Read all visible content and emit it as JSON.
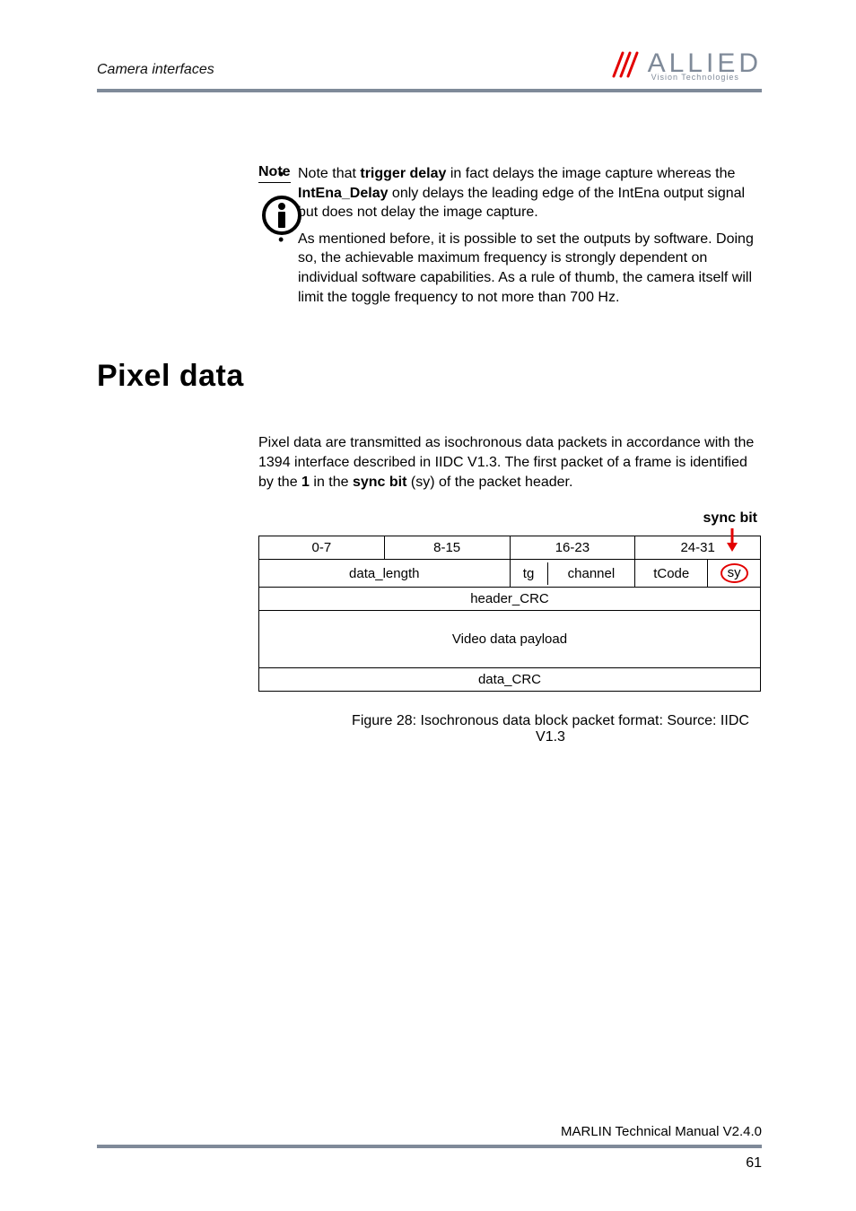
{
  "header": {
    "section": "Camera interfaces",
    "logo_main": "ALLIED",
    "logo_sub": "Vision Technologies"
  },
  "note": {
    "label": "Note",
    "items": [
      {
        "pre": "Note that ",
        "b1": "trigger delay",
        "mid": " in fact delays the image capture whereas the ",
        "b2": "IntEna_Delay",
        "post": " only delays the leading edge of the IntEna output signal but does not delay the image capture."
      },
      {
        "text": "As mentioned before, it is possible to set the outputs by software. Doing so, the achievable maximum frequency is strongly dependent on individual software capabilities. As a rule of thumb, the camera itself will limit the toggle frequency to not more than 700 Hz."
      }
    ]
  },
  "section_title": "Pixel data",
  "body": {
    "pre": "Pixel data are transmitted as isochronous data packets in accordance with the 1394 interface described in IIDC V1.3. The first packet of a frame is identified by the ",
    "b1": "1",
    "mid": " in the ",
    "b2": "sync bit",
    "post": " (sy) of the packet header."
  },
  "diagram": {
    "sync_label": "sync bit",
    "bits": [
      "0-7",
      "8-15",
      "16-23",
      "24-31"
    ],
    "row2": {
      "data_length": "data_length",
      "tg": "tg",
      "channel": "channel",
      "tCode": "tCode",
      "sy": "sy"
    },
    "header_crc": "header_CRC",
    "payload": "Video data payload",
    "data_crc": "data_CRC",
    "caption": "Figure 28: Isochronous data block packet format: Source: IIDC V1.3"
  },
  "footer": {
    "manual": "MARLIN Technical Manual V2.4.0",
    "page": "61"
  }
}
